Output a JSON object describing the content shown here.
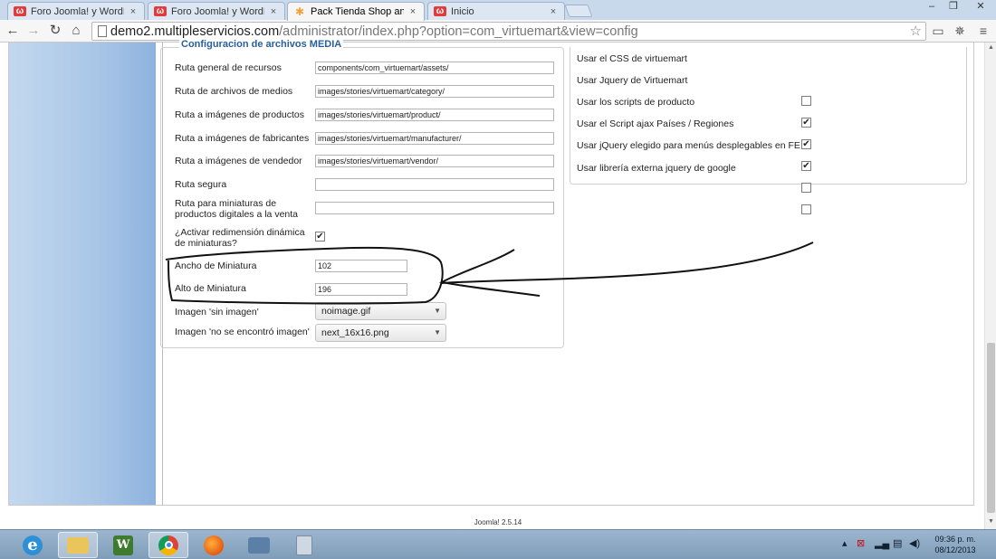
{
  "browser": {
    "tabs": [
      {
        "title": "Foro Joomla! y WordPress",
        "favicon": "joomla-forum-icon"
      },
      {
        "title": "Foro Joomla! y WordPress",
        "favicon": "joomla-forum-icon"
      },
      {
        "title": "Pack Tienda Shop and Buy",
        "favicon": "joomla-icon"
      },
      {
        "title": "Inicio",
        "favicon": "joomla-forum-icon"
      }
    ],
    "tab_close_glyph": "×",
    "url_host": "demo2.multipleservicios.com",
    "url_path": "/administrator/index.php?option=com_virtuemart&view=config"
  },
  "media": {
    "legend": "Configuracion de archivos MEDIA",
    "fields": [
      {
        "label": "Ruta general de recursos",
        "value": "components/com_virtuemart/assets/"
      },
      {
        "label": "Ruta de archivos de medios",
        "value": "images/stories/virtuemart/category/"
      },
      {
        "label": "Ruta a imágenes de productos",
        "value": "images/stories/virtuemart/product/"
      },
      {
        "label": "Ruta a imágenes de fabricantes",
        "value": "images/stories/virtuemart/manufacturer/"
      },
      {
        "label": "Ruta a imágenes de vendedor",
        "value": "images/stories/virtuemart/vendor/"
      },
      {
        "label": "Ruta segura",
        "value": ""
      },
      {
        "label": "Ruta para miniaturas de productos digitales a la venta",
        "value": ""
      }
    ],
    "resize": {
      "label": "¿Activar redimensión dinámica de miniaturas?",
      "checked": true
    },
    "thumb_width": {
      "label": "Ancho de Miniatura",
      "value": "102"
    },
    "thumb_height": {
      "label": "Alto de Miniatura",
      "value": "196"
    },
    "no_image": {
      "label": "Imagen 'sin imagen'",
      "value": "noimage.gif"
    },
    "not_found": {
      "label": "Imagen 'no se encontró imagen'",
      "value": "next_16x16.png"
    }
  },
  "css_js": {
    "options": [
      {
        "label": "Usar el CSS de virtuemart",
        "checked": false
      },
      {
        "label": "Usar Jquery de Virtuemart",
        "checked": true
      },
      {
        "label": "Usar los scripts de producto",
        "checked": true
      },
      {
        "label": "Usar el Script ajax Países / Regiones",
        "checked": true
      },
      {
        "label": "Usar jQuery elegido para menús desplegables en FE",
        "checked": false
      },
      {
        "label": "Usar librería externa jquery de google",
        "checked": false
      }
    ]
  },
  "footer": {
    "text": "Joomla! 2.5.14"
  },
  "taskbar": {
    "apps": [
      "internet-explorer-icon",
      "file-explorer-icon",
      "word-icon",
      "chrome-icon",
      "firefox-icon",
      "network-app-icon",
      "calculator-icon"
    ],
    "clock_time": "09:36 p. m.",
    "clock_date": "08/12/2013"
  },
  "colors": {
    "legend": "#29609c",
    "sidebar": "#a9c6e7",
    "taskbar": "#8aa8c4"
  }
}
